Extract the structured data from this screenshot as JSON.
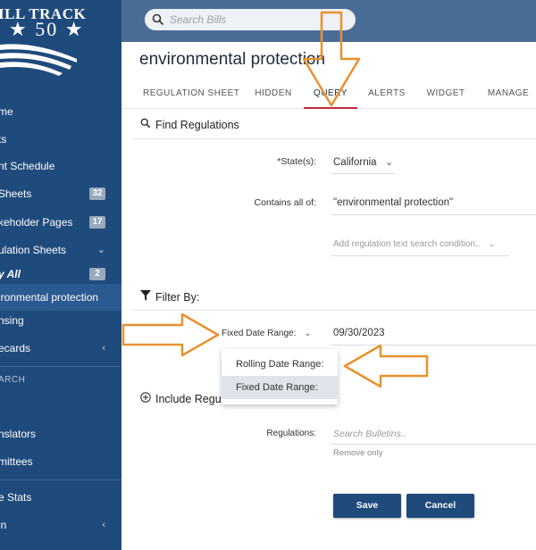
{
  "sidebar": {
    "brand": "ILL TRACK",
    "brand_number": "★ 50 ★",
    "items": [
      {
        "label": "me"
      },
      {
        "label": "ts"
      },
      {
        "label": "nt Schedule"
      },
      {
        "label": "Sheets",
        "badge": "32"
      },
      {
        "label": "keholder Pages",
        "badge": "17"
      },
      {
        "label": "ulation Sheets"
      },
      {
        "label": "y All",
        "badge": "2"
      },
      {
        "label": "ironmental protection"
      },
      {
        "label": "nsing"
      },
      {
        "label": "ecards"
      },
      {
        "label": "nslators"
      },
      {
        "label": "mittees"
      },
      {
        "label": "e Stats"
      },
      {
        "label": "in"
      }
    ],
    "section_search": "ARCH"
  },
  "header": {
    "search_placeholder": "Search Bills"
  },
  "page_title": "environmental protection",
  "tabs": [
    "REGULATION SHEET",
    "HIDDEN",
    "QUERY",
    "ALERTS",
    "WIDGET",
    "MANAGE"
  ],
  "find": {
    "title": "Find Regulations",
    "state_label": "*State(s):",
    "state_value": "California",
    "contains_label": "Contains all of:",
    "contains_value": "\"environmental protection\"",
    "add_condition": "Add regulation text search condition.."
  },
  "filter": {
    "title": "Filter By:",
    "date_label": "Fixed Date Range:",
    "date_value": "09/30/2023",
    "options": [
      "Rolling Date Range:",
      "Fixed Date Range:"
    ]
  },
  "include": {
    "title": "Include Regu",
    "regulations_label": "Regulations:",
    "regulations_placeholder": "Search Bulletins..",
    "remove_only": "Remove only"
  },
  "buttons": {
    "save": "Save",
    "cancel": "Cancel"
  },
  "colors": {
    "sidebar": "#1f4a7c",
    "header": "#4a6d96",
    "active_tab": "#c0283b",
    "annotation_arrow": "#e8912f"
  }
}
